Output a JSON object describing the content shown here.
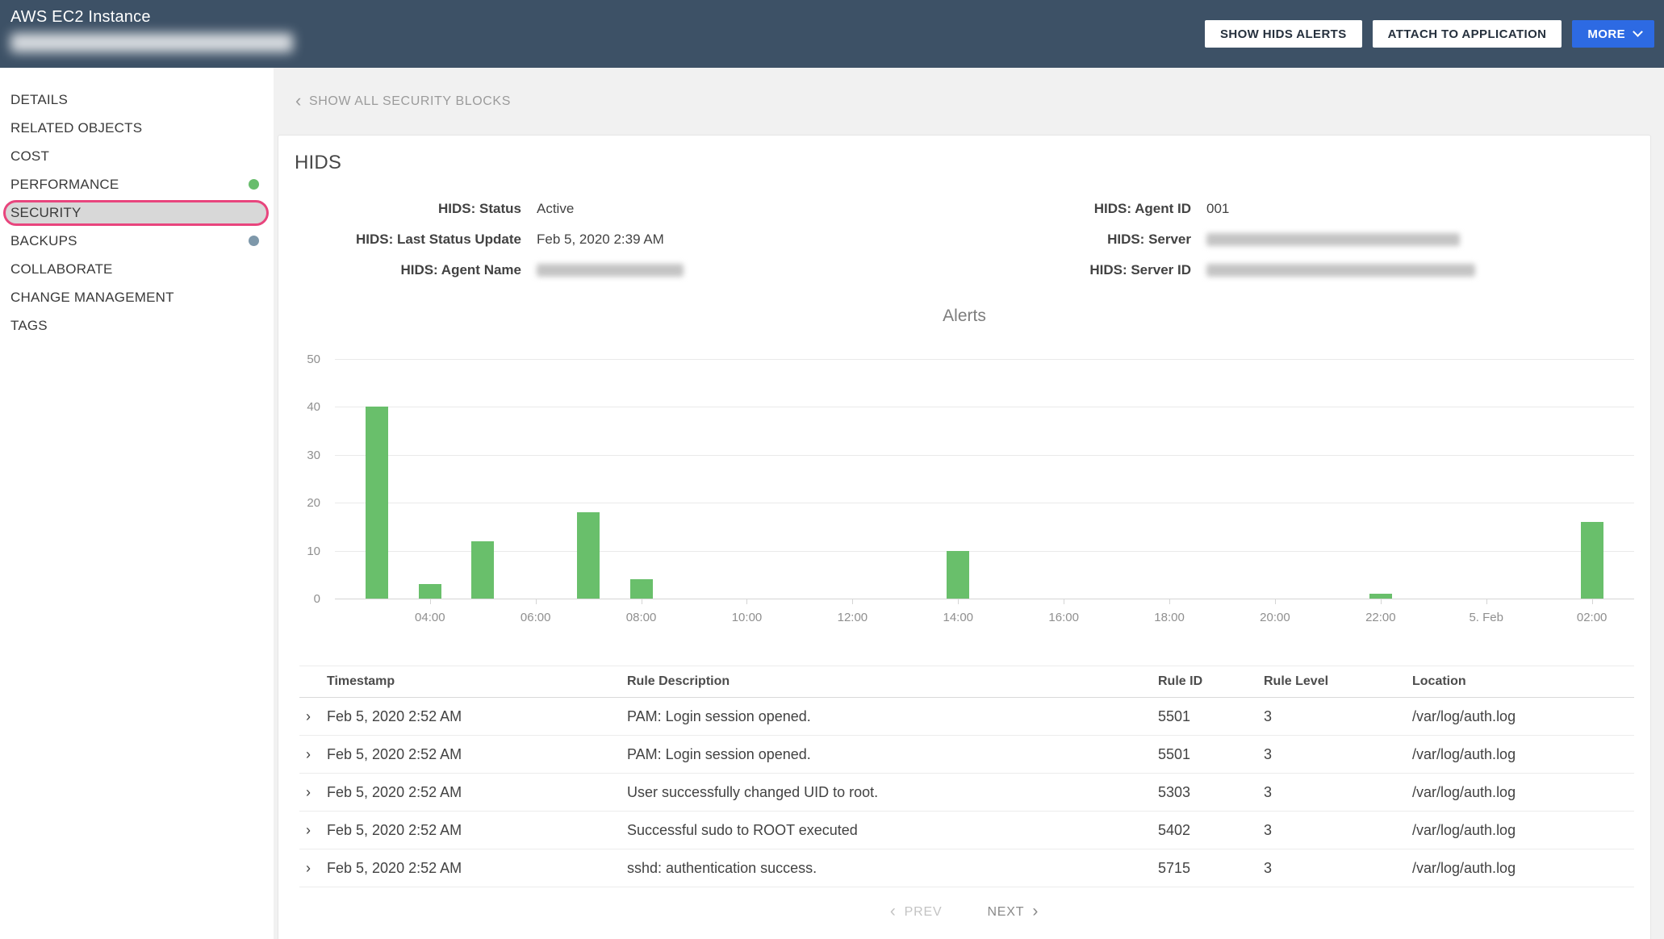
{
  "header": {
    "title": "AWS EC2 Instance",
    "buttons": {
      "show_hids_alerts": "SHOW HIDS ALERTS",
      "attach_to_application": "ATTACH TO APPLICATION",
      "more": "MORE"
    }
  },
  "sidebar": {
    "items": [
      {
        "label": "DETAILS"
      },
      {
        "label": "RELATED OBJECTS"
      },
      {
        "label": "COST"
      },
      {
        "label": "PERFORMANCE",
        "dot_color": "#68bd6c"
      },
      {
        "label": "SECURITY",
        "selected": true,
        "highlight_border": "#e8457d"
      },
      {
        "label": "BACKUPS",
        "dot_color": "#7e98aa"
      },
      {
        "label": "COLLABORATE"
      },
      {
        "label": "CHANGE MANAGEMENT"
      },
      {
        "label": "TAGS"
      }
    ]
  },
  "main": {
    "back_link": "SHOW ALL SECURITY BLOCKS",
    "card_title": "HIDS",
    "details": {
      "left": [
        {
          "label": "HIDS: Status",
          "value": "Active"
        },
        {
          "label": "HIDS: Last Status Update",
          "value": "Feb 5, 2020 2:39 AM"
        },
        {
          "label": "HIDS: Agent Name",
          "value": "",
          "redacted": true
        }
      ],
      "right": [
        {
          "label": "HIDS: Agent ID",
          "value": "001"
        },
        {
          "label": "HIDS: Server",
          "value": "",
          "redacted": true
        },
        {
          "label": "HIDS: Server ID",
          "value": "",
          "redacted": true
        }
      ]
    }
  },
  "chart_data": {
    "type": "bar",
    "title": "Alerts",
    "bar_color": "#69bf6b",
    "ylim": [
      0,
      50
    ],
    "yticks": [
      0,
      10,
      20,
      30,
      40,
      50
    ],
    "axis_start_hour": 2.2,
    "axis_end_hour": 26.8,
    "x_ticks": [
      {
        "label": "04:00",
        "hour": 4
      },
      {
        "label": "06:00",
        "hour": 6
      },
      {
        "label": "08:00",
        "hour": 8
      },
      {
        "label": "10:00",
        "hour": 10
      },
      {
        "label": "12:00",
        "hour": 12
      },
      {
        "label": "14:00",
        "hour": 14
      },
      {
        "label": "16:00",
        "hour": 16
      },
      {
        "label": "18:00",
        "hour": 18
      },
      {
        "label": "20:00",
        "hour": 20
      },
      {
        "label": "22:00",
        "hour": 22
      },
      {
        "label": "5. Feb",
        "hour": 24
      },
      {
        "label": "02:00",
        "hour": 26
      }
    ],
    "bars": [
      {
        "time": "03:00",
        "hour": 3,
        "value": 40
      },
      {
        "time": "04:00",
        "hour": 4,
        "value": 3
      },
      {
        "time": "05:00",
        "hour": 5,
        "value": 12
      },
      {
        "time": "07:00",
        "hour": 7,
        "value": 18
      },
      {
        "time": "08:00",
        "hour": 8,
        "value": 4
      },
      {
        "time": "14:00",
        "hour": 14,
        "value": 10
      },
      {
        "time": "22:00",
        "hour": 22,
        "value": 1
      },
      {
        "time": "02:00",
        "hour": 26,
        "value": 16
      }
    ]
  },
  "table": {
    "columns": [
      "Timestamp",
      "Rule Description",
      "Rule ID",
      "Rule Level",
      "Location"
    ],
    "rows": [
      {
        "timestamp": "Feb 5, 2020 2:52 AM",
        "rule_description": "PAM: Login session opened.",
        "rule_id": "5501",
        "rule_level": "3",
        "location": "/var/log/auth.log"
      },
      {
        "timestamp": "Feb 5, 2020 2:52 AM",
        "rule_description": "PAM: Login session opened.",
        "rule_id": "5501",
        "rule_level": "3",
        "location": "/var/log/auth.log"
      },
      {
        "timestamp": "Feb 5, 2020 2:52 AM",
        "rule_description": "User successfully changed UID to root.",
        "rule_id": "5303",
        "rule_level": "3",
        "location": "/var/log/auth.log"
      },
      {
        "timestamp": "Feb 5, 2020 2:52 AM",
        "rule_description": "Successful sudo to ROOT executed",
        "rule_id": "5402",
        "rule_level": "3",
        "location": "/var/log/auth.log"
      },
      {
        "timestamp": "Feb 5, 2020 2:52 AM",
        "rule_description": "sshd: authentication success.",
        "rule_id": "5715",
        "rule_level": "3",
        "location": "/var/log/auth.log"
      }
    ]
  },
  "pagination": {
    "prev": "PREV",
    "next": "NEXT"
  }
}
